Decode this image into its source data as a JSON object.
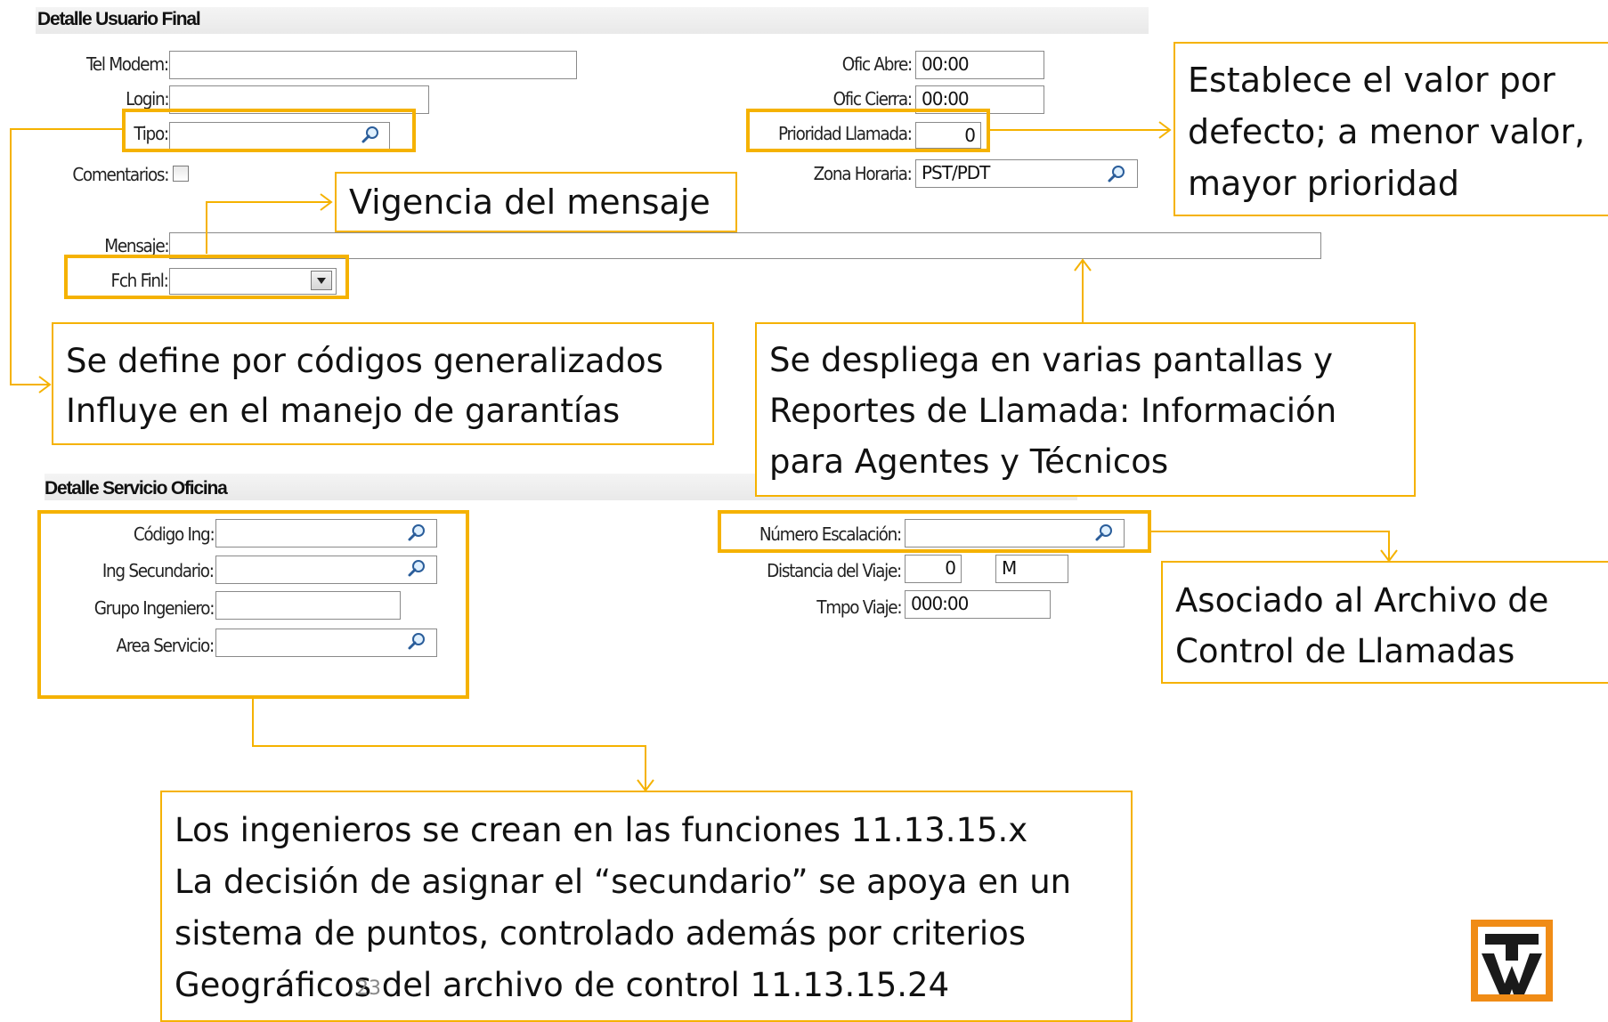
{
  "sections": {
    "usuario_final": {
      "title": "Detalle Usuario Final"
    },
    "servicio_oficina": {
      "title": "Detalle Servicio Oficina"
    }
  },
  "usuario_final": {
    "tel_modem": {
      "label": "Tel Modem:",
      "value": ""
    },
    "login": {
      "label": "Login:",
      "value": ""
    },
    "tipo": {
      "label": "Tipo:",
      "value": ""
    },
    "comentarios": {
      "label": "Comentarios:",
      "checked": false
    },
    "mensaje": {
      "label": "Mensaje:",
      "value": ""
    },
    "fch_finl": {
      "label": "Fch Finl:",
      "value": ""
    },
    "ofic_abre": {
      "label": "Ofic Abre:",
      "value": "00:00"
    },
    "ofic_cierra": {
      "label": "Ofic Cierra:",
      "value": "00:00"
    },
    "prioridad_llamada": {
      "label": "Prioridad Llamada:",
      "value": "0"
    },
    "zona_horaria": {
      "label": "Zona Horaria:",
      "value": "PST/PDT"
    }
  },
  "servicio_oficina": {
    "codigo_ing": {
      "label": "Código Ing:",
      "value": ""
    },
    "ing_secundario": {
      "label": "Ing Secundario:",
      "value": ""
    },
    "grupo_ingeniero": {
      "label": "Grupo Ingeniero:",
      "value": ""
    },
    "area_servicio": {
      "label": "Area Servicio:",
      "value": ""
    },
    "numero_escalacion": {
      "label": "Número Escalación:",
      "value": ""
    },
    "distancia_viaje": {
      "label": "Distancia del Viaje:",
      "value": "0",
      "unit": "M"
    },
    "tmpo_viaje": {
      "label": "Tmpo Viaje:",
      "value": "000:00"
    }
  },
  "callouts": {
    "prioridad": [
      "Establece el valor por",
      "defecto; a menor valor,",
      "mayor prioridad"
    ],
    "vigencia": [
      "Vigencia del mensaje"
    ],
    "tipo": [
      "Se define por códigos generalizados",
      "Influye en el manejo de garantías"
    ],
    "mensaje": [
      "Se despliega en varias pantallas y",
      "Reportes de Llamada: Información",
      "para Agentes y Técnicos"
    ],
    "escalacion": [
      "Asociado al Archivo de",
      "Control de Llamadas"
    ],
    "ingenieros": [
      "Los ingenieros se crean  en las funciones  11.13.15.x",
      "La decisión de asignar el “secundario” se apoya en un",
      "sistema de puntos, controlado además por criterios",
      "Geográficos  del  archivo de control  11.13.15.24"
    ]
  },
  "page_number": "23",
  "colors": {
    "highlight": "#f5b200",
    "logo": "#f08c16"
  },
  "icons": {
    "lookup": "magnifier-icon",
    "dropdown": "chevron-down-icon"
  }
}
